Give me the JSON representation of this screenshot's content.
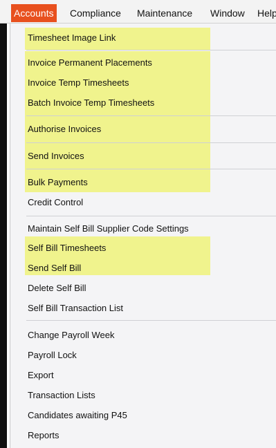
{
  "menubar": {
    "items": [
      {
        "label": "Accounts"
      },
      {
        "label": "Compliance"
      },
      {
        "label": "Maintenance"
      },
      {
        "label": "Window"
      },
      {
        "label": "Help"
      }
    ]
  },
  "menu": {
    "items": [
      {
        "label": "Timesheet Image Link"
      },
      {
        "label": "Invoice Permanent Placements"
      },
      {
        "label": "Invoice Temp Timesheets"
      },
      {
        "label": "Batch Invoice Temp Timesheets"
      },
      {
        "label": "Authorise Invoices"
      },
      {
        "label": "Send Invoices"
      },
      {
        "label": "Bulk Payments"
      },
      {
        "label": "Credit Control"
      },
      {
        "label": "Maintain Self Bill Supplier Code Settings"
      },
      {
        "label": "Self Bill Timesheets"
      },
      {
        "label": "Send Self Bill"
      },
      {
        "label": "Delete Self Bill"
      },
      {
        "label": "Self Bill Transaction List"
      },
      {
        "label": "Change Payroll Week"
      },
      {
        "label": "Payroll Lock"
      },
      {
        "label": "Export"
      },
      {
        "label": "Transaction Lists"
      },
      {
        "label": "Candidates awaiting P45"
      },
      {
        "label": "Reports"
      }
    ]
  },
  "colors": {
    "active_menu_bg": "#e8501e",
    "highlight": "#eef27a"
  }
}
